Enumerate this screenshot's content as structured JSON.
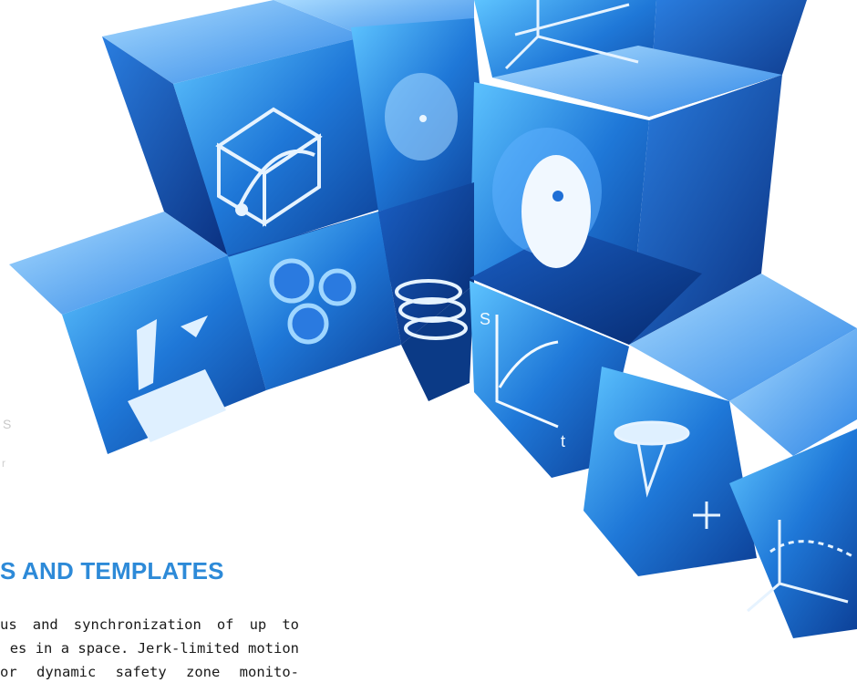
{
  "section": {
    "heading": "S AND TEMPLATES",
    "body_lines": [
      "us and synchronization of up to",
      "es in a space. Jerk-limited motion",
      "or dynamic safety zone monito-"
    ]
  },
  "graph_cube": {
    "y_axis_label": "S",
    "x_axis_label": "t"
  },
  "ghost_text": {
    "fragment_a": "S",
    "fragment_b": "r"
  },
  "colors": {
    "heading": "#2d8ad8",
    "cube_light": "#6fb9ff",
    "cube_mid": "#1f6fd6",
    "cube_dark": "#0a3a8f",
    "icon": "#dff0ff"
  },
  "icons": [
    "cube-rotation-icon",
    "disc-icon",
    "axes-3d-icon",
    "cam-disc-icon",
    "hand-cut-icon",
    "gears-icon",
    "spiral-helix-icon",
    "s-curve-graph-icon",
    "delta-robot-icon",
    "trajectory-axes-icon"
  ]
}
